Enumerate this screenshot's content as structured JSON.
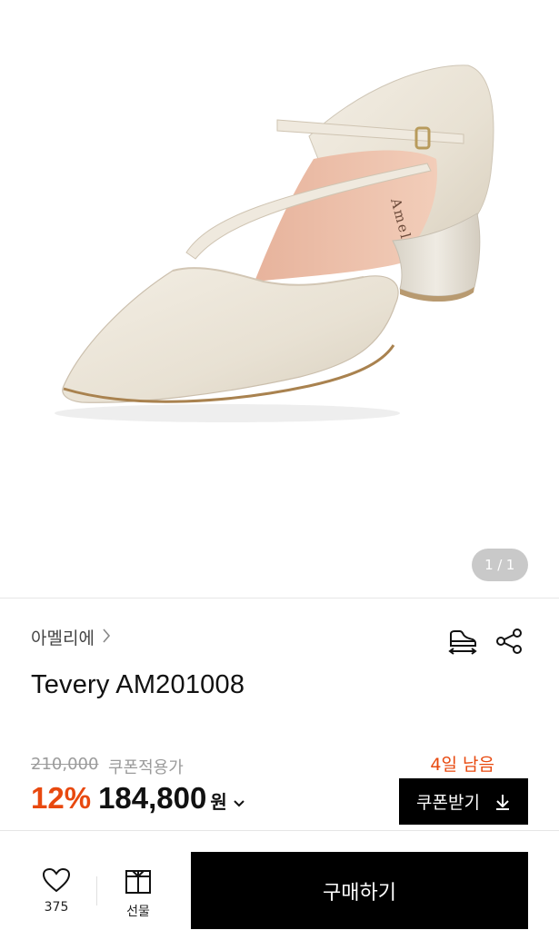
{
  "gallery": {
    "current": "1",
    "separator": "/",
    "total": "1",
    "product_image": "beige pointed-toe d'Orsay pump with ankle strap and block heel"
  },
  "product": {
    "brand": "아멜리에",
    "name": "Tevery AM201008",
    "insole_print": "Amellie"
  },
  "pricing": {
    "original_price": "210,000",
    "coupon_note": "쿠폰적용가",
    "discount": "12%",
    "sale_price": "184,800",
    "currency": "원",
    "remaining": "4일 남음"
  },
  "coupon": {
    "label": "쿠폰받기"
  },
  "bottom_bar": {
    "wishlist_count": "375",
    "gift_label": "선물",
    "buy_label": "구매하기"
  },
  "colors": {
    "accent": "#e8490f",
    "primary_button": "#000000",
    "counter_bg": "#c9c9c9"
  }
}
